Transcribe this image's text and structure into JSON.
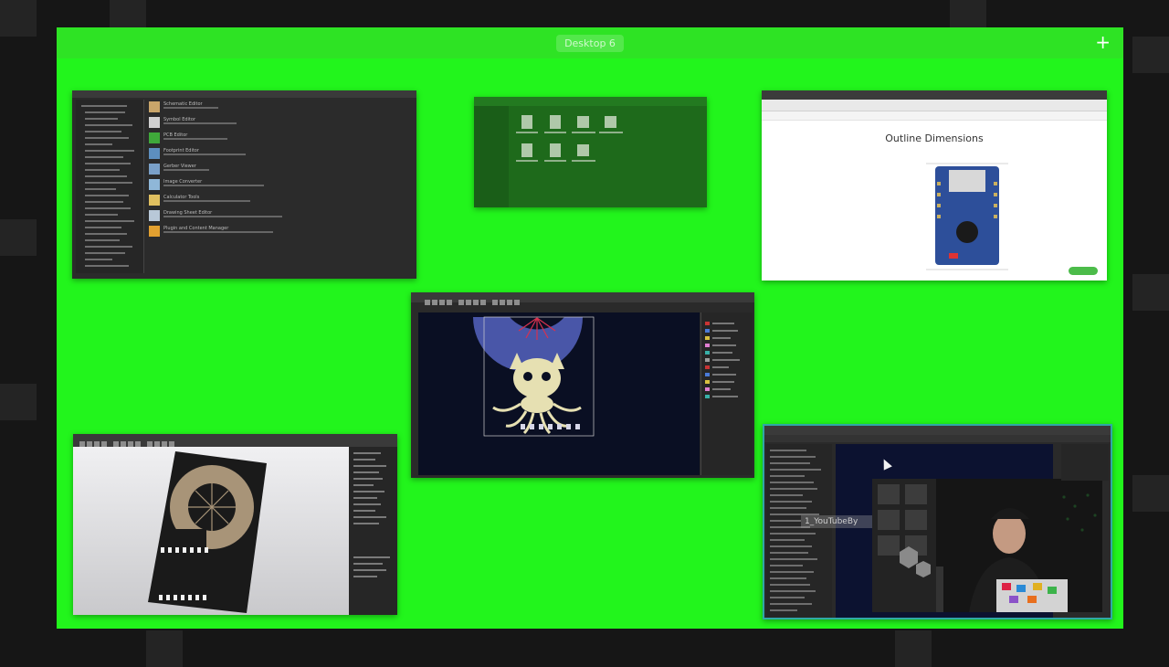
{
  "desktop": {
    "label": "Desktop 6",
    "add_label": "+"
  },
  "windows": {
    "libraries": {
      "items": [
        {
          "label": "Schematic Editor"
        },
        {
          "label": "Symbol Editor"
        },
        {
          "label": "PCB Editor"
        },
        {
          "label": "Footprint Editor"
        },
        {
          "label": "Gerber Viewer"
        },
        {
          "label": "Image Converter"
        },
        {
          "label": "Calculator Tools"
        },
        {
          "label": "Drawing Sheet Editor"
        },
        {
          "label": "Plugin and Content Manager"
        }
      ]
    },
    "browser": {
      "heading": "Outline Dimensions"
    },
    "video": {
      "overlay_label": "1_YouTubeBy"
    }
  },
  "colors": {
    "screen_bg": "#22f51c",
    "window_dark": "#2b2b2b",
    "pcb_bg": "#0a0f23",
    "highlight_border": "#2fa8a6"
  }
}
